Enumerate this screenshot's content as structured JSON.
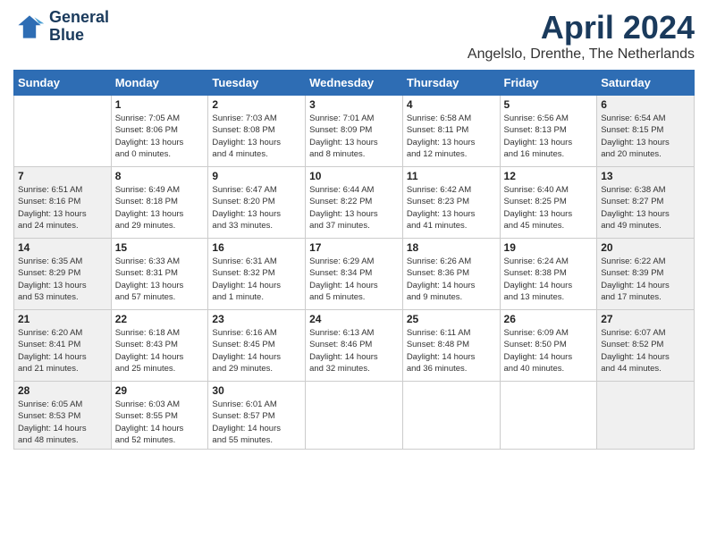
{
  "header": {
    "logo_line1": "General",
    "logo_line2": "Blue",
    "title": "April 2024",
    "subtitle": "Angelslo, Drenthe, The Netherlands"
  },
  "days_of_week": [
    "Sunday",
    "Monday",
    "Tuesday",
    "Wednesday",
    "Thursday",
    "Friday",
    "Saturday"
  ],
  "weeks": [
    [
      {
        "num": "",
        "info": "",
        "shaded": false
      },
      {
        "num": "1",
        "info": "Sunrise: 7:05 AM\nSunset: 8:06 PM\nDaylight: 13 hours\nand 0 minutes.",
        "shaded": false
      },
      {
        "num": "2",
        "info": "Sunrise: 7:03 AM\nSunset: 8:08 PM\nDaylight: 13 hours\nand 4 minutes.",
        "shaded": false
      },
      {
        "num": "3",
        "info": "Sunrise: 7:01 AM\nSunset: 8:09 PM\nDaylight: 13 hours\nand 8 minutes.",
        "shaded": false
      },
      {
        "num": "4",
        "info": "Sunrise: 6:58 AM\nSunset: 8:11 PM\nDaylight: 13 hours\nand 12 minutes.",
        "shaded": false
      },
      {
        "num": "5",
        "info": "Sunrise: 6:56 AM\nSunset: 8:13 PM\nDaylight: 13 hours\nand 16 minutes.",
        "shaded": false
      },
      {
        "num": "6",
        "info": "Sunrise: 6:54 AM\nSunset: 8:15 PM\nDaylight: 13 hours\nand 20 minutes.",
        "shaded": true
      }
    ],
    [
      {
        "num": "7",
        "info": "Sunrise: 6:51 AM\nSunset: 8:16 PM\nDaylight: 13 hours\nand 24 minutes.",
        "shaded": true
      },
      {
        "num": "8",
        "info": "Sunrise: 6:49 AM\nSunset: 8:18 PM\nDaylight: 13 hours\nand 29 minutes.",
        "shaded": false
      },
      {
        "num": "9",
        "info": "Sunrise: 6:47 AM\nSunset: 8:20 PM\nDaylight: 13 hours\nand 33 minutes.",
        "shaded": false
      },
      {
        "num": "10",
        "info": "Sunrise: 6:44 AM\nSunset: 8:22 PM\nDaylight: 13 hours\nand 37 minutes.",
        "shaded": false
      },
      {
        "num": "11",
        "info": "Sunrise: 6:42 AM\nSunset: 8:23 PM\nDaylight: 13 hours\nand 41 minutes.",
        "shaded": false
      },
      {
        "num": "12",
        "info": "Sunrise: 6:40 AM\nSunset: 8:25 PM\nDaylight: 13 hours\nand 45 minutes.",
        "shaded": false
      },
      {
        "num": "13",
        "info": "Sunrise: 6:38 AM\nSunset: 8:27 PM\nDaylight: 13 hours\nand 49 minutes.",
        "shaded": true
      }
    ],
    [
      {
        "num": "14",
        "info": "Sunrise: 6:35 AM\nSunset: 8:29 PM\nDaylight: 13 hours\nand 53 minutes.",
        "shaded": true
      },
      {
        "num": "15",
        "info": "Sunrise: 6:33 AM\nSunset: 8:31 PM\nDaylight: 13 hours\nand 57 minutes.",
        "shaded": false
      },
      {
        "num": "16",
        "info": "Sunrise: 6:31 AM\nSunset: 8:32 PM\nDaylight: 14 hours\nand 1 minute.",
        "shaded": false
      },
      {
        "num": "17",
        "info": "Sunrise: 6:29 AM\nSunset: 8:34 PM\nDaylight: 14 hours\nand 5 minutes.",
        "shaded": false
      },
      {
        "num": "18",
        "info": "Sunrise: 6:26 AM\nSunset: 8:36 PM\nDaylight: 14 hours\nand 9 minutes.",
        "shaded": false
      },
      {
        "num": "19",
        "info": "Sunrise: 6:24 AM\nSunset: 8:38 PM\nDaylight: 14 hours\nand 13 minutes.",
        "shaded": false
      },
      {
        "num": "20",
        "info": "Sunrise: 6:22 AM\nSunset: 8:39 PM\nDaylight: 14 hours\nand 17 minutes.",
        "shaded": true
      }
    ],
    [
      {
        "num": "21",
        "info": "Sunrise: 6:20 AM\nSunset: 8:41 PM\nDaylight: 14 hours\nand 21 minutes.",
        "shaded": true
      },
      {
        "num": "22",
        "info": "Sunrise: 6:18 AM\nSunset: 8:43 PM\nDaylight: 14 hours\nand 25 minutes.",
        "shaded": false
      },
      {
        "num": "23",
        "info": "Sunrise: 6:16 AM\nSunset: 8:45 PM\nDaylight: 14 hours\nand 29 minutes.",
        "shaded": false
      },
      {
        "num": "24",
        "info": "Sunrise: 6:13 AM\nSunset: 8:46 PM\nDaylight: 14 hours\nand 32 minutes.",
        "shaded": false
      },
      {
        "num": "25",
        "info": "Sunrise: 6:11 AM\nSunset: 8:48 PM\nDaylight: 14 hours\nand 36 minutes.",
        "shaded": false
      },
      {
        "num": "26",
        "info": "Sunrise: 6:09 AM\nSunset: 8:50 PM\nDaylight: 14 hours\nand 40 minutes.",
        "shaded": false
      },
      {
        "num": "27",
        "info": "Sunrise: 6:07 AM\nSunset: 8:52 PM\nDaylight: 14 hours\nand 44 minutes.",
        "shaded": true
      }
    ],
    [
      {
        "num": "28",
        "info": "Sunrise: 6:05 AM\nSunset: 8:53 PM\nDaylight: 14 hours\nand 48 minutes.",
        "shaded": true
      },
      {
        "num": "29",
        "info": "Sunrise: 6:03 AM\nSunset: 8:55 PM\nDaylight: 14 hours\nand 52 minutes.",
        "shaded": false
      },
      {
        "num": "30",
        "info": "Sunrise: 6:01 AM\nSunset: 8:57 PM\nDaylight: 14 hours\nand 55 minutes.",
        "shaded": false
      },
      {
        "num": "",
        "info": "",
        "shaded": false
      },
      {
        "num": "",
        "info": "",
        "shaded": false
      },
      {
        "num": "",
        "info": "",
        "shaded": false
      },
      {
        "num": "",
        "info": "",
        "shaded": true
      }
    ]
  ]
}
